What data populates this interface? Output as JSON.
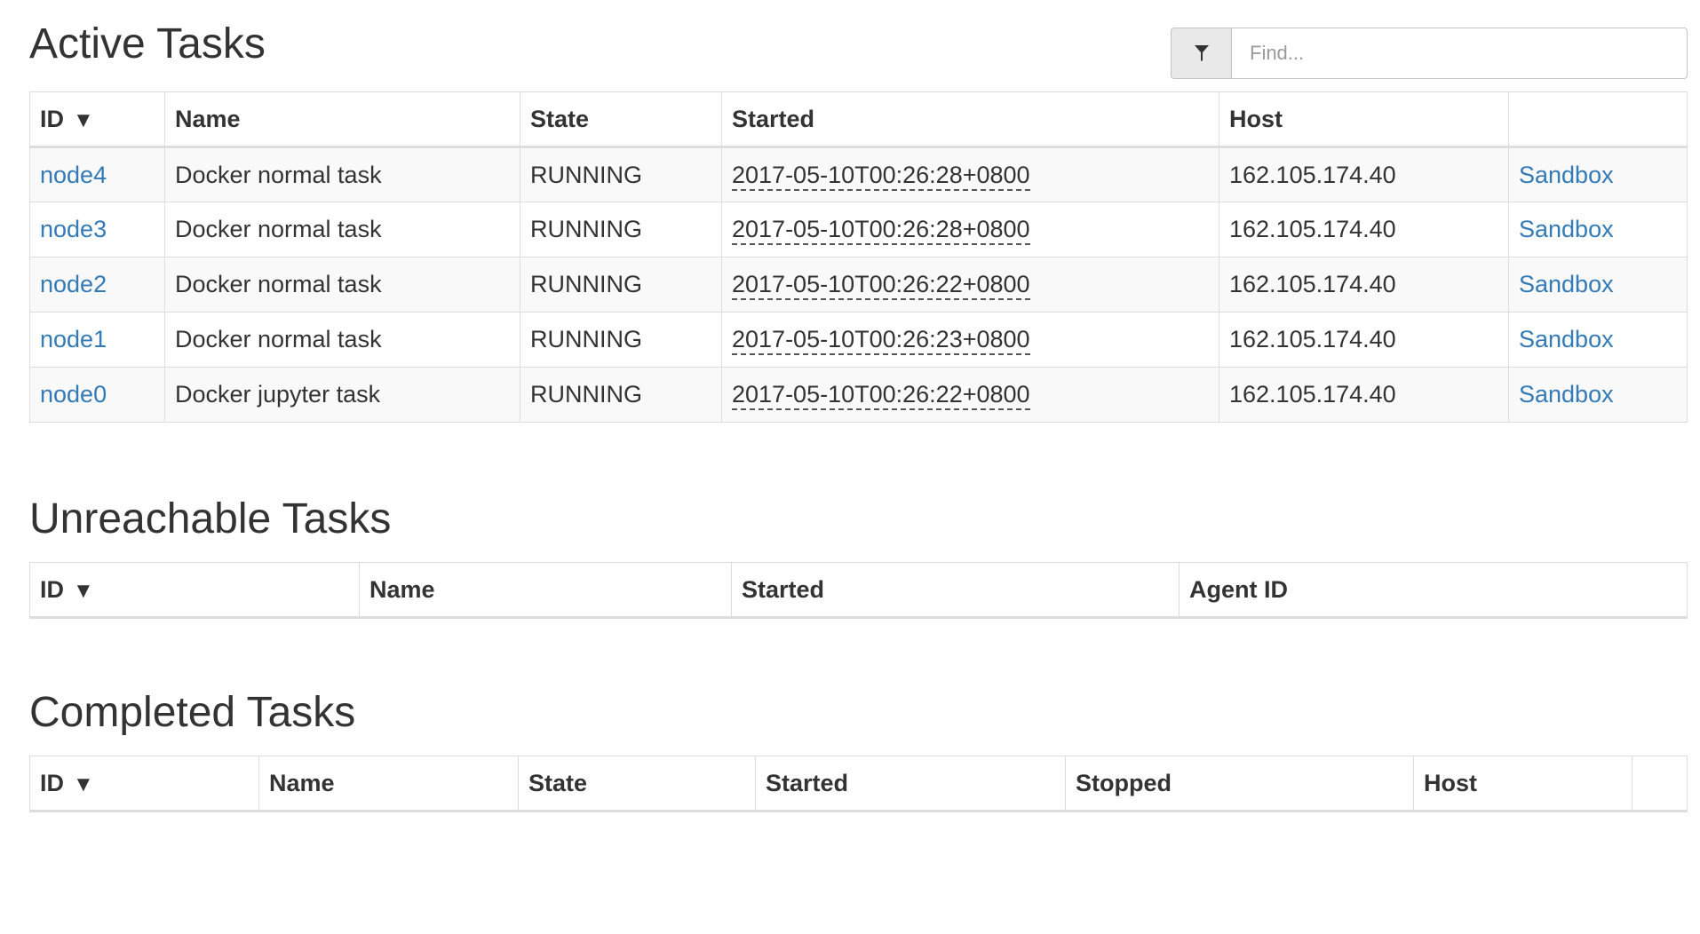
{
  "find": {
    "placeholder": "Find..."
  },
  "active": {
    "title": "Active Tasks",
    "headers": {
      "id": "ID",
      "id_sort": "▼",
      "name": "Name",
      "state": "State",
      "started": "Started",
      "host": "Host",
      "action": ""
    },
    "rows": [
      {
        "id": "node4",
        "name": "Docker normal task",
        "state": "RUNNING",
        "started": "2017-05-10T00:26:28+0800",
        "host": "162.105.174.40",
        "action": "Sandbox"
      },
      {
        "id": "node3",
        "name": "Docker normal task",
        "state": "RUNNING",
        "started": "2017-05-10T00:26:28+0800",
        "host": "162.105.174.40",
        "action": "Sandbox"
      },
      {
        "id": "node2",
        "name": "Docker normal task",
        "state": "RUNNING",
        "started": "2017-05-10T00:26:22+0800",
        "host": "162.105.174.40",
        "action": "Sandbox"
      },
      {
        "id": "node1",
        "name": "Docker normal task",
        "state": "RUNNING",
        "started": "2017-05-10T00:26:23+0800",
        "host": "162.105.174.40",
        "action": "Sandbox"
      },
      {
        "id": "node0",
        "name": "Docker jupyter task",
        "state": "RUNNING",
        "started": "2017-05-10T00:26:22+0800",
        "host": "162.105.174.40",
        "action": "Sandbox"
      }
    ]
  },
  "unreachable": {
    "title": "Unreachable Tasks",
    "headers": {
      "id": "ID",
      "id_sort": "▼",
      "name": "Name",
      "started": "Started",
      "agent_id": "Agent ID"
    }
  },
  "completed": {
    "title": "Completed Tasks",
    "headers": {
      "id": "ID",
      "id_sort": "▼",
      "name": "Name",
      "state": "State",
      "started": "Started",
      "stopped": "Stopped",
      "host": "Host",
      "action": ""
    }
  },
  "colors": {
    "link": "#337ab7",
    "text": "#333333",
    "border": "#dddddd",
    "stripe": "#f9f9f9"
  },
  "icons": {
    "filter": "filter-icon"
  }
}
